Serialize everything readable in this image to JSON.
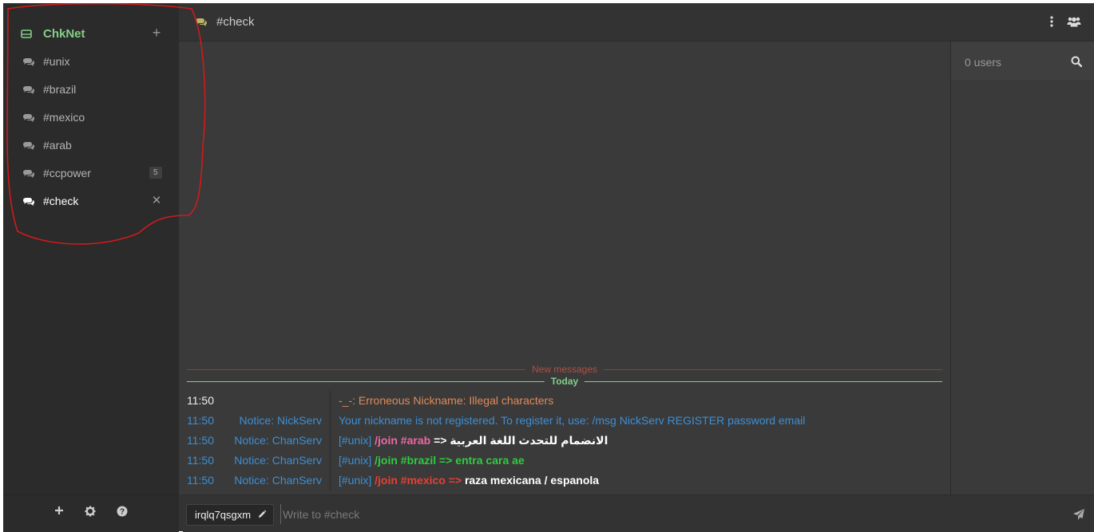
{
  "network": {
    "name": "ChkNet",
    "add_icon": "plus-icon"
  },
  "channels": [
    {
      "name": "#unix"
    },
    {
      "name": "#brazil"
    },
    {
      "name": "#mexico"
    },
    {
      "name": "#arab"
    },
    {
      "name": "#ccpower",
      "badge": "5"
    },
    {
      "name": "#check",
      "active": true
    }
  ],
  "sidebar_footer": {
    "icons": [
      "plus-icon",
      "gear-icon",
      "help-icon"
    ]
  },
  "header": {
    "title": "#check",
    "icons": [
      "vertical-dots-icon",
      "users-icon"
    ]
  },
  "chat": {
    "new_messages_label": "New messages",
    "today_label": "Today",
    "messages": [
      {
        "time": "11:50",
        "from": "",
        "text": "-_-: Erroneous Nickname: Illegal characters",
        "kind": "error"
      },
      {
        "time": "11:50",
        "from": "Notice: NickServ",
        "text": "Your nickname is not registered. To register it, use: /msg NickServ REGISTER password email",
        "kind": "notice"
      },
      {
        "time": "11:50",
        "from": "Notice: ChanServ",
        "prefix": "[#unix]",
        "command": "/join #arab",
        "arrow": "=>",
        "tail": "الانضمام للتحدث اللغة العربية",
        "kind": "arab"
      },
      {
        "time": "11:50",
        "from": "Notice: ChanServ",
        "prefix": "[#unix]",
        "command": "/join #brazil",
        "arrow": "=>",
        "tail": "entra cara ae",
        "kind": "brazil"
      },
      {
        "time": "11:50",
        "from": "Notice: ChanServ",
        "prefix": "[#unix]",
        "command": "/join #mexico",
        "arrow": "=>",
        "tail": "raza mexicana / espanola",
        "kind": "mexico"
      }
    ]
  },
  "userlist": {
    "count_label": "0 users",
    "search_icon": "search-icon"
  },
  "input": {
    "nick": "irqlq7qsgxm",
    "placeholder": "Write to #check",
    "send_icon": "send-icon"
  },
  "colors": {
    "network": "#84ce88",
    "notice": "#3c8fd5",
    "error": "#e08a5a",
    "annotation": "#d11a1a"
  }
}
